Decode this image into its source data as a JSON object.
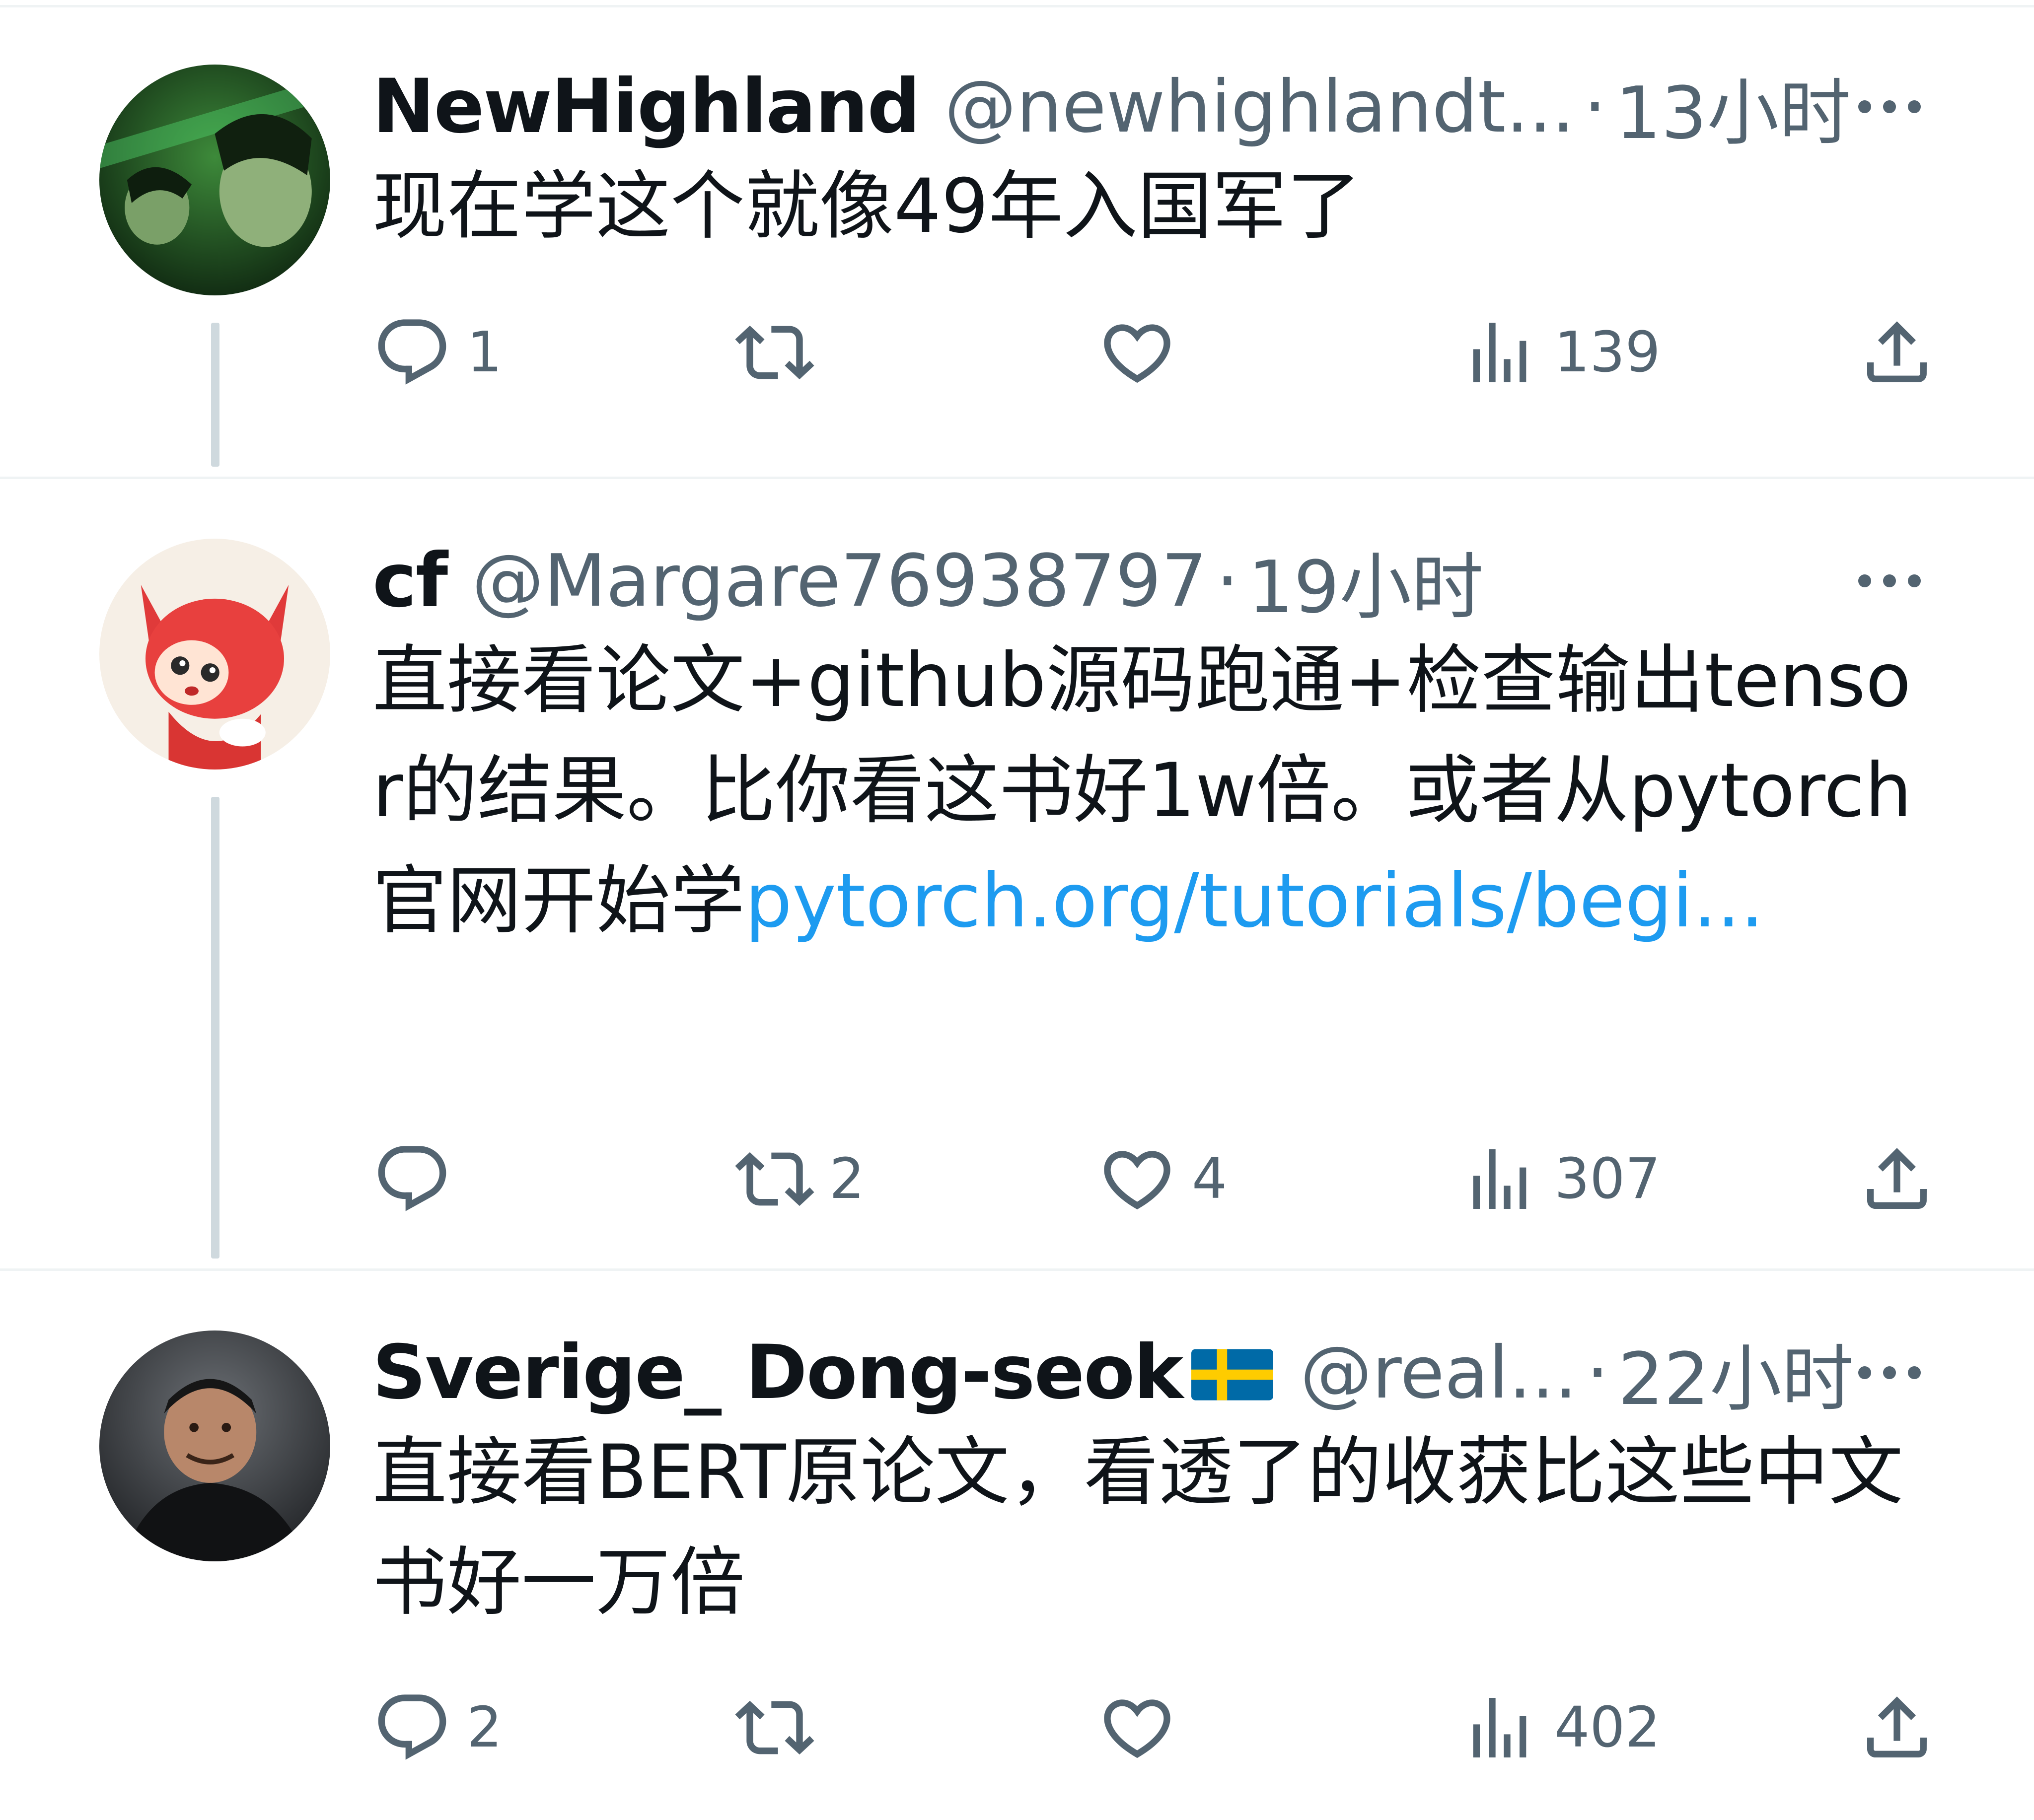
{
  "tweets": [
    {
      "name": "NewHighland",
      "handle": "@newhighlandt...",
      "time": "13小时",
      "text": "现在学这个就像49年入国军了",
      "link_text": "",
      "reply_count": "1",
      "retweet_count": "",
      "like_count": "",
      "view_count": "139"
    },
    {
      "name": "cf",
      "handle": "@Margare76938797",
      "time": "19小时",
      "text": "直接看论文+github源码跑通+检查输出tensor的结果。比你看这书好1w倍。或者从pytorch官网开始学",
      "link_text": "pytorch.org/tutorials/begi...",
      "reply_count": "",
      "retweet_count": "2",
      "like_count": "4",
      "view_count": "307"
    },
    {
      "name": "Sverige_ Dong-seok",
      "handle": "@real...",
      "time": "22小时",
      "text": "直接看BERT原论文，看透了的收获比这些中文书好一万倍",
      "link_text": "",
      "reply_count": "2",
      "retweet_count": "",
      "like_count": "",
      "view_count": "402"
    }
  ],
  "separator": "·",
  "icons": {
    "more": "more-horizontal-icon",
    "reply": "reply-bubble-icon",
    "retweet": "retweet-icon",
    "like": "heart-icon",
    "views": "views-bar-chart-icon",
    "share": "share-upload-icon",
    "flag": "sweden-flag-icon"
  },
  "colors": {
    "text": "#0f1419",
    "secondary": "#536471",
    "link": "#1d9bf0",
    "divider": "#eff3f4",
    "thread_line": "#cfd9de"
  }
}
